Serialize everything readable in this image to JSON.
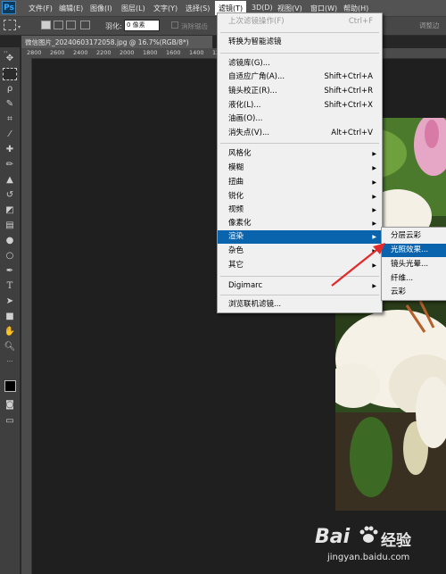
{
  "app": {
    "logo": "Ps"
  },
  "menubar": {
    "items": [
      "文件(F)",
      "编辑(E)",
      "图像(I)",
      "图层(L)",
      "文字(Y)",
      "选择(S)",
      "滤镜(T)",
      "3D(D)",
      "视图(V)",
      "窗口(W)",
      "帮助(H)"
    ]
  },
  "options": {
    "feather_label": "羽化:",
    "feather_value": "0 像素",
    "antialias_label": "消除锯齿",
    "right_button": "调整边"
  },
  "document": {
    "tab_title": "微信图片_20240603172058.jpg @ 16.7%(RGB/8*)",
    "ruler_marks": [
      "2800",
      "2600",
      "2400",
      "2200",
      "2000",
      "1800",
      "1600",
      "1400",
      "1200",
      "1000",
      "800",
      "600",
      "400",
      "200",
      "0"
    ]
  },
  "filter_menu": {
    "last_filter": {
      "label": "上次滤镜操作(F)",
      "shortcut": "Ctrl+F"
    },
    "smart_filter": "转换为智能滤镜",
    "gallery": {
      "label": "滤镜库(G)..."
    },
    "adaptive": {
      "label": "自适应广角(A)...",
      "shortcut": "Shift+Ctrl+A"
    },
    "lens_correction": {
      "label": "镜头校正(R)...",
      "shortcut": "Shift+Ctrl+R"
    },
    "liquify": {
      "label": "液化(L)...",
      "shortcut": "Shift+Ctrl+X"
    },
    "oil_paint": {
      "label": "油画(O)..."
    },
    "vanishing_point": {
      "label": "消失点(V)...",
      "shortcut": "Alt+Ctrl+V"
    },
    "groups": [
      "风格化",
      "模糊",
      "扭曲",
      "锐化",
      "视频",
      "像素化",
      "渲染",
      "杂色",
      "其它"
    ],
    "digimarc": "Digimarc",
    "browse_online": "浏览联机滤镜..."
  },
  "render_submenu": {
    "items": [
      "分层云彩",
      "光照效果...",
      "镜头光晕...",
      "纤维...",
      "云彩"
    ]
  },
  "watermark": {
    "brand": "Bai",
    "brand2": "经验",
    "url": "jingyan.baidu.com"
  }
}
